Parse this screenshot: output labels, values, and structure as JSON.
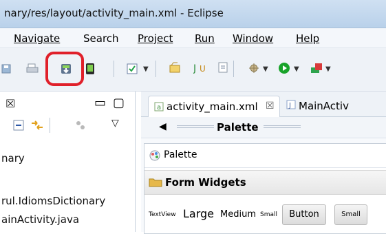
{
  "window": {
    "title": "nary/res/layout/activity_main.xml - Eclipse"
  },
  "menubar": {
    "items": [
      "Navigate",
      "Search",
      "Project",
      "Run",
      "Window",
      "Help"
    ]
  },
  "left_view": {
    "close_glyph": "☒",
    "min_glyph": "▭",
    "max_glyph": "▢",
    "menu_glyph": "▽",
    "rows": [
      "nary",
      "rul.IdiomsDictionary",
      "ainActivity.java"
    ]
  },
  "editor": {
    "tabs": {
      "active": "activity_main.xml",
      "other": "MainActiv"
    },
    "palette_strip_label": "Palette",
    "palette_title": "Palette",
    "section_title": "Form Widgets",
    "widgets": {
      "textview": "TextView",
      "large": "Large",
      "medium": "Medium",
      "small": "Small",
      "button": "Button",
      "small_button": "Small"
    }
  },
  "colors": {
    "highlight": "#e0202a",
    "run_green": "#18a32a"
  }
}
